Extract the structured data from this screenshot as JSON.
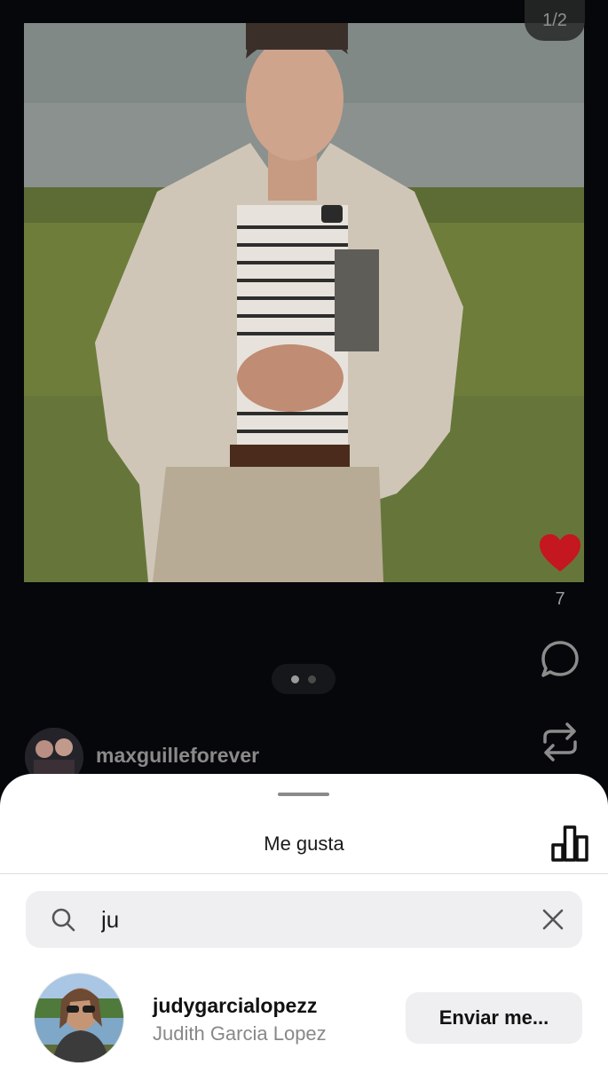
{
  "post": {
    "image_counter": "1/2",
    "like_count": "7",
    "author_username": "maxguilleforever"
  },
  "likes_sheet": {
    "title": "Me gusta",
    "search": {
      "value": "ju"
    },
    "results": [
      {
        "username": "judygarcialopezz",
        "full_name": "Judith Garcia Lopez",
        "action_label": "Enviar me..."
      }
    ]
  },
  "colors": {
    "like_heart": "#c4171f",
    "cursor": "#0f8a7a"
  }
}
